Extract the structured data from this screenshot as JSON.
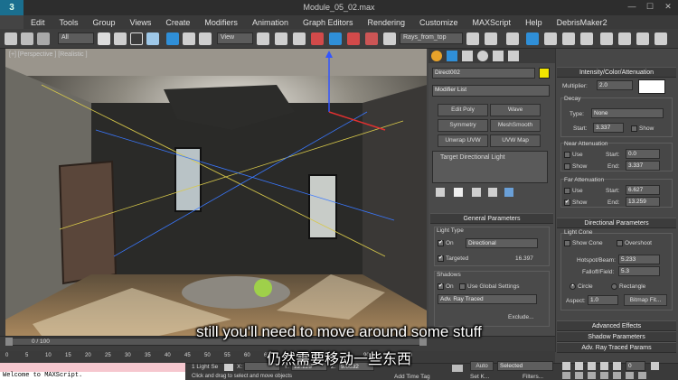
{
  "window": {
    "title": "Module_05_02.max",
    "app_logo": "3",
    "controls": [
      "—",
      "☐",
      "✕"
    ]
  },
  "menu": [
    "Edit",
    "Tools",
    "Group",
    "Views",
    "Create",
    "Modifiers",
    "Animation",
    "Graph Editors",
    "Rendering",
    "Customize",
    "MAXScript",
    "Help",
    "DebrisMaker2"
  ],
  "toolbar": {
    "selection_filter": "All",
    "ref_coord": "View",
    "named_selection": "Rays_from_top"
  },
  "viewport": {
    "label": "[+] [Perspective ] [Realistic ]"
  },
  "command_panel": {
    "object_name": "Direct002",
    "object_color": "#f2e600",
    "modifier_list": "Modifier List",
    "modifier_buttons": [
      "Edit Poly",
      "Wave",
      "Symmetry",
      "MeshSmooth",
      "Unwrap UVW",
      "UVW Map"
    ],
    "stack_item": "Target Directional Light",
    "general": {
      "header": "General Parameters",
      "light_type_label": "Light Type",
      "on_label": "On",
      "light_type": "Directional",
      "targeted_label": "Targeted",
      "target_distance": "16.397",
      "shadows_label": "Shadows",
      "shadows_on_label": "On",
      "use_global_label": "Use Global Settings",
      "shadow_type": "Adv. Ray Traced",
      "exclude_label": "Exclude..."
    }
  },
  "rollouts": {
    "intensity_header": "Intensity/Color/Attenuation",
    "multiplier_label": "Multiplier:",
    "multiplier": "2.0",
    "light_color": "#ffffff",
    "decay_label": "Decay",
    "decay_type_label": "Type:",
    "decay_type": "None",
    "decay_start_label": "Start:",
    "decay_start": "3.337",
    "decay_show_label": "Show",
    "near_label": "Near Attenuation",
    "near_use_label": "Use",
    "near_start_label": "Start:",
    "near_start": "0.0",
    "near_show_label": "Show",
    "near_end_label": "End:",
    "near_end": "3.337",
    "far_label": "Far Attenuation",
    "far_use_label": "Use",
    "far_start_label": "Start:",
    "far_start": "6.627",
    "far_show_label": "Show",
    "far_end_label": "End:",
    "far_end": "13.259",
    "directional_header": "Directional Parameters",
    "light_cone_label": "Light Cone",
    "show_cone_label": "Show Cone",
    "overshoot_label": "Overshoot",
    "hotspot_label": "Hotspot/Beam:",
    "hotspot": "5.233",
    "falloff_label": "Falloff/Field:",
    "falloff": "5.3",
    "circle_label": "Circle",
    "rectangle_label": "Rectangle",
    "aspect_label": "Aspect:",
    "aspect": "1.0",
    "bitmap_fit_label": "Bitmap Fit...",
    "advanced_effects": "Advanced Effects",
    "shadow_params": "Shadow Parameters",
    "adv_ray_params": "Adv. Ray Traced Params"
  },
  "timeline": {
    "frame": "0 / 100",
    "ticks": [
      "0",
      "5",
      "10",
      "15",
      "20",
      "25",
      "30",
      "35",
      "40",
      "45",
      "50",
      "55",
      "60",
      "65",
      "70",
      "75",
      "80",
      "85",
      "90",
      "95",
      "100"
    ]
  },
  "status": {
    "maxscript_output": "Welcome to MAXScript.",
    "selection": "1 Light Se",
    "x_label": "X:",
    "y_label": "Y:",
    "y_value": "12.125",
    "z_label": "Z:",
    "z_value": "5.0632",
    "prompt": "Click and drag to select and move objects",
    "auto_key": "Auto",
    "set_key": "Set K...",
    "key_filter_value": "Selected",
    "filters_label": "Filters...",
    "add_time_tag": "Add Time Tag",
    "frame_value": "0"
  },
  "subtitles": {
    "en": "still you'll need to move around some stuff",
    "zh": "仍然需要移动一些东西"
  }
}
